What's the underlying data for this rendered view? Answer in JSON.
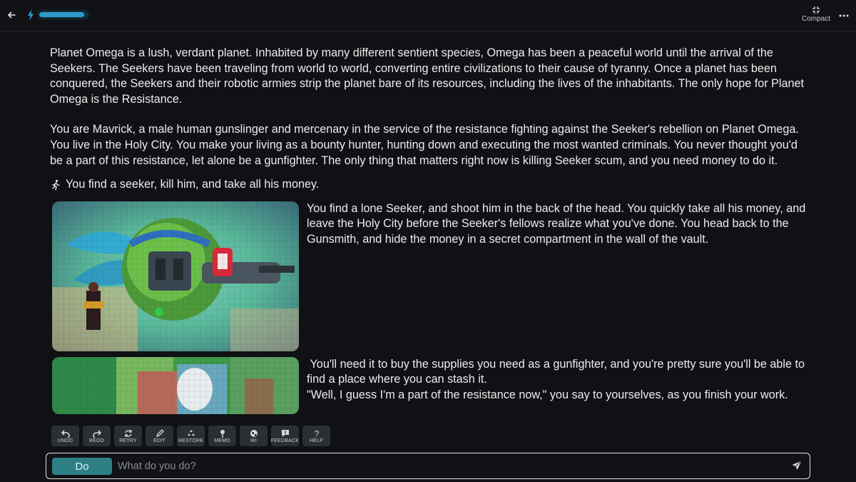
{
  "topbar": {
    "progress": 0.93,
    "compact_label": "Compact"
  },
  "story": {
    "intro_1": "Planet Omega is a lush, verdant planet. Inhabited by many different sentient species, Omega has been a peaceful world until the arrival of the Seekers. The Seekers have been traveling from world to world, converting entire civilizations to their cause of tyranny. Once a planet has been conquered, the Seekers and their robotic armies strip the planet bare of its resources, including the lives of the inhabitants. The only hope for Planet Omega is the Resistance.",
    "intro_2": "You are Mavrick, a male human gunslinger and mercenary in the service of the resistance fighting against the Seeker's rebellion on Planet Omega. You live in the Holy City. You make your living as a bounty hunter, hunting down and executing the most wanted criminals. You never thought you'd be a part of this resistance, let alone be a gunfighter. The only thing that matters right now is killing Seeker scum, and you need money to do it.",
    "player_action": "You find a seeker, kill him, and take all his money.",
    "response_1": "You find a lone Seeker, and shoot him in the back of the head. You quickly take all his money, and leave the Holy City before the Seeker's fellows realize what you've done. You head back to the Gunsmith, and hide the money in a secret compartment in the wall of the vault.",
    "response_2": " You'll need it to buy the supplies you need as a gunfighter, and you're pretty sure you'll be able to find a place where you can stash it.",
    "response_3": "\"Well, I guess I'm a part of the resistance now,\" you say to yourselves, as you finish your work."
  },
  "actions": [
    {
      "label": "UNDO",
      "icon": "undo-icon"
    },
    {
      "label": "REDO",
      "icon": "redo-icon"
    },
    {
      "label": "RETRY",
      "icon": "retry-icon"
    },
    {
      "label": "EDIT",
      "icon": "pencil-icon"
    },
    {
      "label": "RESTORE",
      "icon": "recycle-icon"
    },
    {
      "label": "MEMO",
      "icon": "pin-icon"
    },
    {
      "label": "WI",
      "icon": "globe-icon"
    },
    {
      "label": "FEEDBACK",
      "icon": "feedback-icon"
    },
    {
      "label": "HELP",
      "icon": "help-icon"
    }
  ],
  "input": {
    "mode": "Do",
    "placeholder": "What do you do?"
  },
  "colors": {
    "accent": "#2f7f86",
    "progress": "#2f9cc8",
    "background": "#0f1115"
  }
}
